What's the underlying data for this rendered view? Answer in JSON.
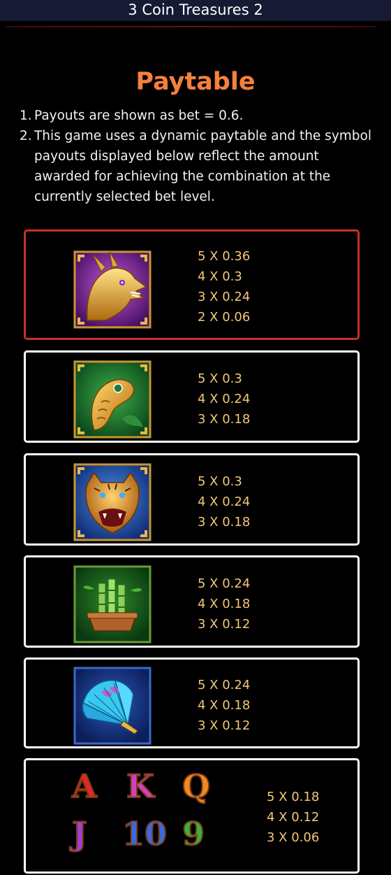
{
  "header": {
    "title": "3 Coin Treasures 2"
  },
  "paytable": {
    "heading": "Paytable",
    "rules": [
      {
        "num": "1.",
        "text": "Payouts are shown as bet = 0.6."
      },
      {
        "num": "2.",
        "text": "This game uses a dynamic paytable and the symbol payouts displayed below reflect the amount awarded for achieving the combination at the currently selected bet level."
      }
    ],
    "symbols": [
      {
        "icon": "dragon-symbol-icon",
        "selected": true,
        "payouts": [
          "5 X 0.36",
          "4 X 0.3",
          "3 X 0.24",
          "2 X 0.06"
        ]
      },
      {
        "icon": "goldfish-symbol-icon",
        "selected": false,
        "payouts": [
          "5 X 0.3",
          "4 X 0.24",
          "3 X 0.18"
        ]
      },
      {
        "icon": "tiger-symbol-icon",
        "selected": false,
        "payouts": [
          "5 X 0.3",
          "4 X 0.24",
          "3 X 0.18"
        ]
      },
      {
        "icon": "bamboo-pot-symbol-icon",
        "selected": false,
        "payouts": [
          "5 X 0.24",
          "4 X 0.18",
          "3 X 0.12"
        ]
      },
      {
        "icon": "blue-fan-symbol-icon",
        "selected": false,
        "payouts": [
          "5 X 0.24",
          "4 X 0.18",
          "3 X 0.12"
        ]
      },
      {
        "icon": "card-letters-symbol-icon",
        "letters": [
          "A",
          "K",
          "Q",
          "J",
          "10",
          "9"
        ],
        "selected": false,
        "payouts": [
          "5 X 0.18",
          "4 X 0.12",
          "3 X 0.06"
        ]
      }
    ]
  },
  "colors": {
    "accent": "#f5803e",
    "payout_text": "#f3c779",
    "selected_border": "#c9302c",
    "card_border": "#ffffff",
    "title_bar": "#161a33"
  }
}
